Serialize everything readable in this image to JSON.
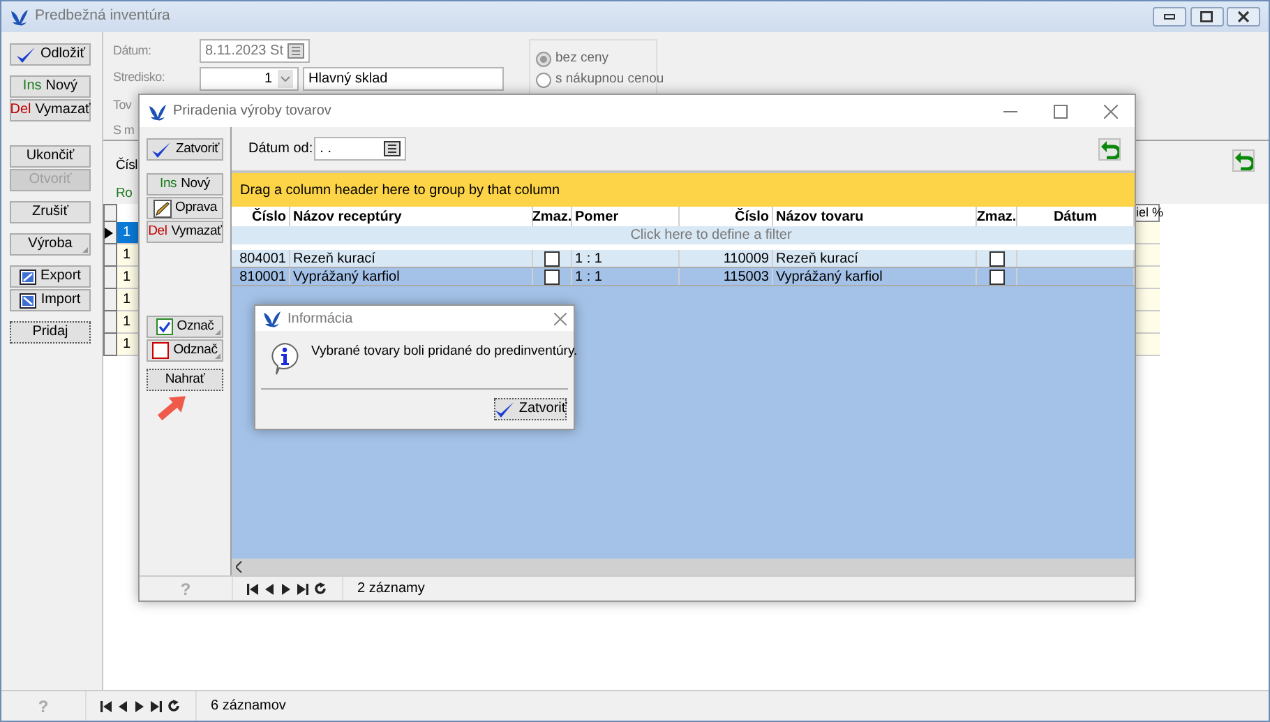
{
  "main_window": {
    "title": "Predbežná inventúra",
    "sidebar_groups": [
      [
        {
          "kind": "check",
          "label": "Odložiť",
          "disabled": false,
          "dropdown": false,
          "focused": false
        }
      ],
      [
        {
          "kind": "insert",
          "key": "Ins",
          "label": "Nový",
          "disabled": false,
          "dropdown": false,
          "focused": false
        },
        {
          "kind": "delete",
          "key": "Del",
          "label": "Vymazať",
          "disabled": false,
          "dropdown": false,
          "focused": false
        }
      ],
      [
        {
          "kind": "plain",
          "label": "Ukončiť",
          "disabled": false,
          "dropdown": false,
          "focused": false
        },
        {
          "kind": "plain",
          "label": "Otvoriť",
          "disabled": true,
          "dropdown": false,
          "focused": false
        }
      ],
      [
        {
          "kind": "plain",
          "label": "Zrušiť",
          "disabled": false,
          "dropdown": false,
          "focused": false
        }
      ],
      [
        {
          "kind": "plain",
          "label": "Výroba",
          "disabled": false,
          "dropdown": true,
          "focused": false
        }
      ],
      [
        {
          "kind": "export",
          "label": "Export",
          "disabled": false,
          "dropdown": false,
          "focused": false
        },
        {
          "kind": "import",
          "label": "Import",
          "disabled": false,
          "dropdown": false,
          "focused": false
        }
      ],
      [
        {
          "kind": "plain",
          "label": "Pridaj",
          "disabled": false,
          "dropdown": false,
          "focused": true
        }
      ]
    ],
    "form": {
      "date_label": "Dátum:",
      "date_value": "8.11.2023 St",
      "center_label": "Stredisko:",
      "center_number": "1",
      "center_name": "Hlavný sklad",
      "label_3": "Tov",
      "label_4": "S m"
    },
    "price_options": [
      {
        "label": "bez ceny",
        "selected": true
      },
      {
        "label": "s nákupnou cenou",
        "selected": false
      }
    ],
    "section_label": "Čísl",
    "section_note": "Ro",
    "grid": {
      "last_column": "iel %",
      "rows": [
        {
          "cell": "1",
          "selected": true
        },
        {
          "cell": "1",
          "selected": false
        },
        {
          "cell": "1",
          "selected": false
        },
        {
          "cell": "1",
          "selected": false
        },
        {
          "cell": "1",
          "selected": false
        },
        {
          "cell": "1",
          "selected": false
        }
      ]
    },
    "status_bar": {
      "help": "?",
      "count": "6 záznamov"
    }
  },
  "dialog": {
    "title": "Priradenia výroby tovarov",
    "sidebar_groups": [
      [
        {
          "kind": "check",
          "label": "Zatvoriť",
          "dropdown": false,
          "focused": false
        }
      ],
      [
        {
          "kind": "insert",
          "key": "Ins",
          "label": "Nový",
          "dropdown": false,
          "focused": false
        },
        {
          "kind": "edit",
          "label": "Oprava",
          "dropdown": false,
          "focused": false
        },
        {
          "kind": "delete",
          "key": "Del",
          "label": "Vymazať",
          "dropdown": false,
          "focused": false
        }
      ],
      [
        {
          "kind": "mark",
          "label": "Označ",
          "dropdown": true,
          "focused": false
        },
        {
          "kind": "unmark",
          "label": "Odznač",
          "dropdown": true,
          "focused": false
        }
      ],
      [
        {
          "kind": "plain",
          "label": "Nahrať",
          "dropdown": false,
          "focused": true
        }
      ]
    ],
    "date_from_label": "Dátum od:",
    "date_from_value": ". .",
    "group_panel": "Drag a column header here to group by that column",
    "columns": [
      "Číslo",
      "Názov receptúry",
      "Zmaz.",
      "Pomer",
      "Číslo",
      "Názov tovaru",
      "Zmaz.",
      "Dátum"
    ],
    "filter_row": "Click here to define a filter",
    "rows": [
      {
        "selected": false,
        "recipe_no": "804001",
        "recipe_name": "Rezeň kurací",
        "recipe_deleted": false,
        "ratio": "1 : 1",
        "item_no": "110009",
        "item_name": "Rezeň kurací",
        "item_deleted": false
      },
      {
        "selected": true,
        "recipe_no": "810001",
        "recipe_name": "Vyprážaný karfiol",
        "recipe_deleted": false,
        "ratio": "1 : 1",
        "item_no": "115003",
        "item_name": "Vyprážaný karfiol",
        "item_deleted": false
      }
    ],
    "status_bar": {
      "help": "?",
      "count": "2 záznamy"
    }
  },
  "message_box": {
    "title": "Informácia",
    "message": "Vybrané tovary boli pridané do predinventúry.",
    "button": "Zatvoriť"
  }
}
